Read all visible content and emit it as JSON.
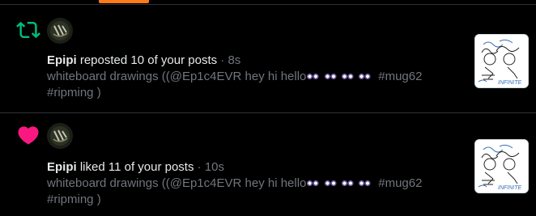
{
  "colors": {
    "background": "#000000",
    "tab_indicator": "#ff7a1a",
    "repost_green": "#00ba7c",
    "like_pink": "#f91880",
    "muted_text": "#71767b",
    "primary_text": "#e7e9ea"
  },
  "notifications": [
    {
      "type": "repost",
      "icon": "repost-icon",
      "user_name": "Epipi",
      "action_text": " reposted 10 of your posts",
      "separator": " · ",
      "time": "8s",
      "snippet_text": "whiteboard drawings ((@Ep1c4EVR hey hi hello",
      "snippet_tags": "#mug62",
      "snippet_tail": "#ripming )",
      "emoji": "eyes-emoji"
    },
    {
      "type": "like",
      "icon": "heart-icon",
      "user_name": "Epipi",
      "action_text": " liked 11 of your posts",
      "separator": " · ",
      "time": "10s",
      "snippet_text": "whiteboard drawings ((@Ep1c4EVR hey hi hello",
      "snippet_tags": "#mug62",
      "snippet_tail": "#ripming )",
      "emoji": "eyes-emoji"
    }
  ]
}
